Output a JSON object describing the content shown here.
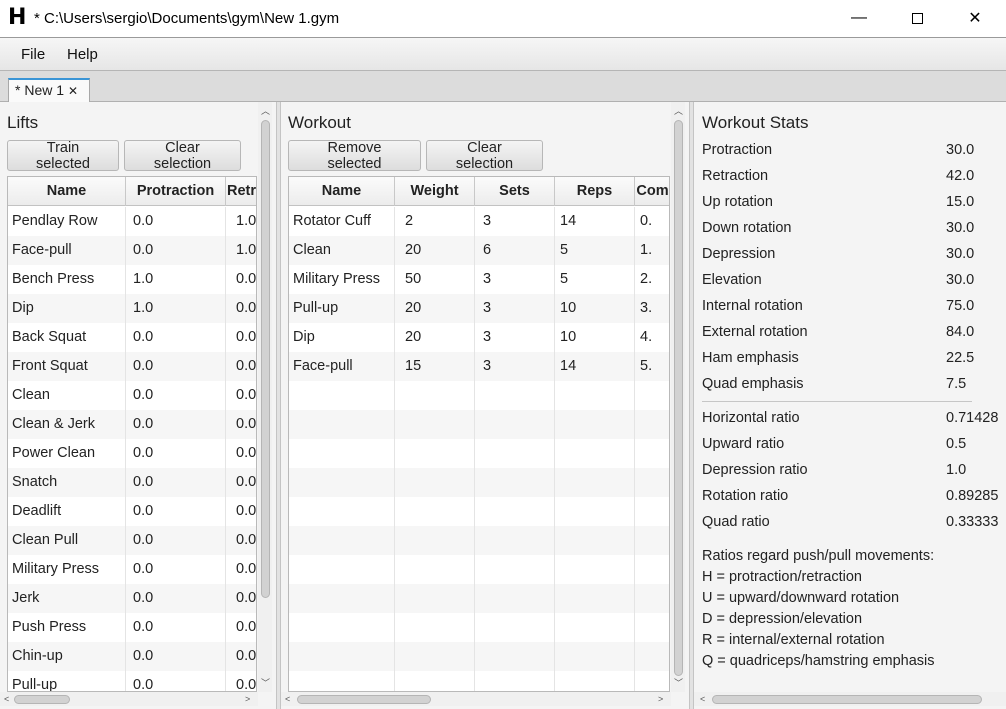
{
  "window": {
    "title": "* C:\\Users\\sergio\\Documents\\gym\\New 1.gym",
    "logo": "H",
    "minimize": "—",
    "close": "✕"
  },
  "menu": [
    "File",
    "Help"
  ],
  "tab": {
    "label": "* New 1",
    "close": "✕"
  },
  "lifts": {
    "title": "Lifts",
    "train_button": "Train selected",
    "clear_button": "Clear selection",
    "columns": [
      "Name",
      "Protraction",
      "Retr"
    ],
    "rows": [
      [
        "Pendlay Row",
        "0.0",
        "1.0"
      ],
      [
        "Face-pull",
        "0.0",
        "1.0"
      ],
      [
        "Bench Press",
        "1.0",
        "0.0"
      ],
      [
        "Dip",
        "1.0",
        "0.0"
      ],
      [
        "Back Squat",
        "0.0",
        "0.0"
      ],
      [
        "Front Squat",
        "0.0",
        "0.0"
      ],
      [
        "Clean",
        "0.0",
        "0.0"
      ],
      [
        "Clean & Jerk",
        "0.0",
        "0.0"
      ],
      [
        "Power Clean",
        "0.0",
        "0.0"
      ],
      [
        "Snatch",
        "0.0",
        "0.0"
      ],
      [
        "Deadlift",
        "0.0",
        "0.0"
      ],
      [
        "Clean Pull",
        "0.0",
        "0.0"
      ],
      [
        "Military Press",
        "0.0",
        "0.0"
      ],
      [
        "Jerk",
        "0.0",
        "0.0"
      ],
      [
        "Push Press",
        "0.0",
        "0.0"
      ],
      [
        "Chin-up",
        "0.0",
        "0.0"
      ],
      [
        "Pull-up",
        "0.0",
        "0.0"
      ]
    ]
  },
  "workout": {
    "title": "Workout",
    "remove_button": "Remove selected",
    "clear_button": "Clear selection",
    "columns": [
      "Name",
      "Weight",
      "Sets",
      "Reps",
      "Com"
    ],
    "rows": [
      [
        "Rotator Cuff",
        "2",
        "3",
        "14",
        "0."
      ],
      [
        "Clean",
        "20",
        "6",
        "5",
        "1."
      ],
      [
        "Military Press",
        "50",
        "3",
        "5",
        "2."
      ],
      [
        "Pull-up",
        "20",
        "3",
        "10",
        "3."
      ],
      [
        "Dip",
        "20",
        "3",
        "10",
        "4."
      ],
      [
        "Face-pull",
        "15",
        "3",
        "14",
        "5."
      ]
    ]
  },
  "stats": {
    "title": "Workout Stats",
    "metrics": [
      [
        "Protraction",
        "30.0"
      ],
      [
        "Retraction",
        "42.0"
      ],
      [
        "Up rotation",
        "15.0"
      ],
      [
        "Down rotation",
        "30.0"
      ],
      [
        "Depression",
        "30.0"
      ],
      [
        "Elevation",
        "30.0"
      ],
      [
        "Internal rotation",
        "75.0"
      ],
      [
        "External rotation",
        "84.0"
      ],
      [
        "Ham emphasis",
        "22.5"
      ],
      [
        "Quad emphasis",
        "7.5"
      ]
    ],
    "ratios": [
      [
        "Horizontal ratio",
        "0.71428"
      ],
      [
        "Upward ratio",
        "0.5"
      ],
      [
        "Depression ratio",
        "1.0"
      ],
      [
        "Rotation ratio",
        "0.89285"
      ],
      [
        "Quad ratio",
        "0.33333"
      ]
    ],
    "notes": [
      "Ratios regard push/pull movements:",
      "H = protraction/retraction",
      "U = upward/downward rotation",
      "D = depression/elevation",
      "R = internal/external rotation",
      "Q = quadriceps/hamstring emphasis"
    ]
  }
}
